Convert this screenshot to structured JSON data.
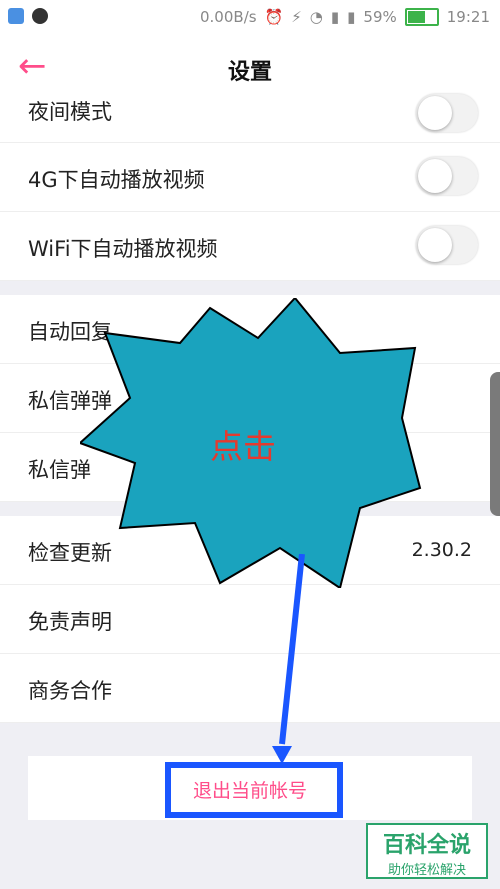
{
  "status": {
    "network": "0.00B/s",
    "battery": "59%",
    "battery_level": 59,
    "time": "19:21"
  },
  "header": {
    "back_icon": "←",
    "title": "设置"
  },
  "settings": {
    "night_mode": "夜间模式",
    "auto_play_4g": "4G下自动播放视频",
    "auto_play_wifi": "WiFi下自动播放视频",
    "auto_reply": "自动回复",
    "dm_popup_1": "私信弹弹",
    "dm_popup_2": "私信弹",
    "check_update": "检查更新",
    "version": "2.30.2",
    "disclaimer": "免责声明",
    "business": "商务合作",
    "logout": "退出当前帐号"
  },
  "annotation": {
    "click_label": "点击"
  },
  "watermark": {
    "top": "百科全说",
    "bottom": "助你轻松解决"
  },
  "colors": {
    "accent": "#ff4d8a",
    "burst": "#1aa3be",
    "box": "#1a56ff"
  }
}
